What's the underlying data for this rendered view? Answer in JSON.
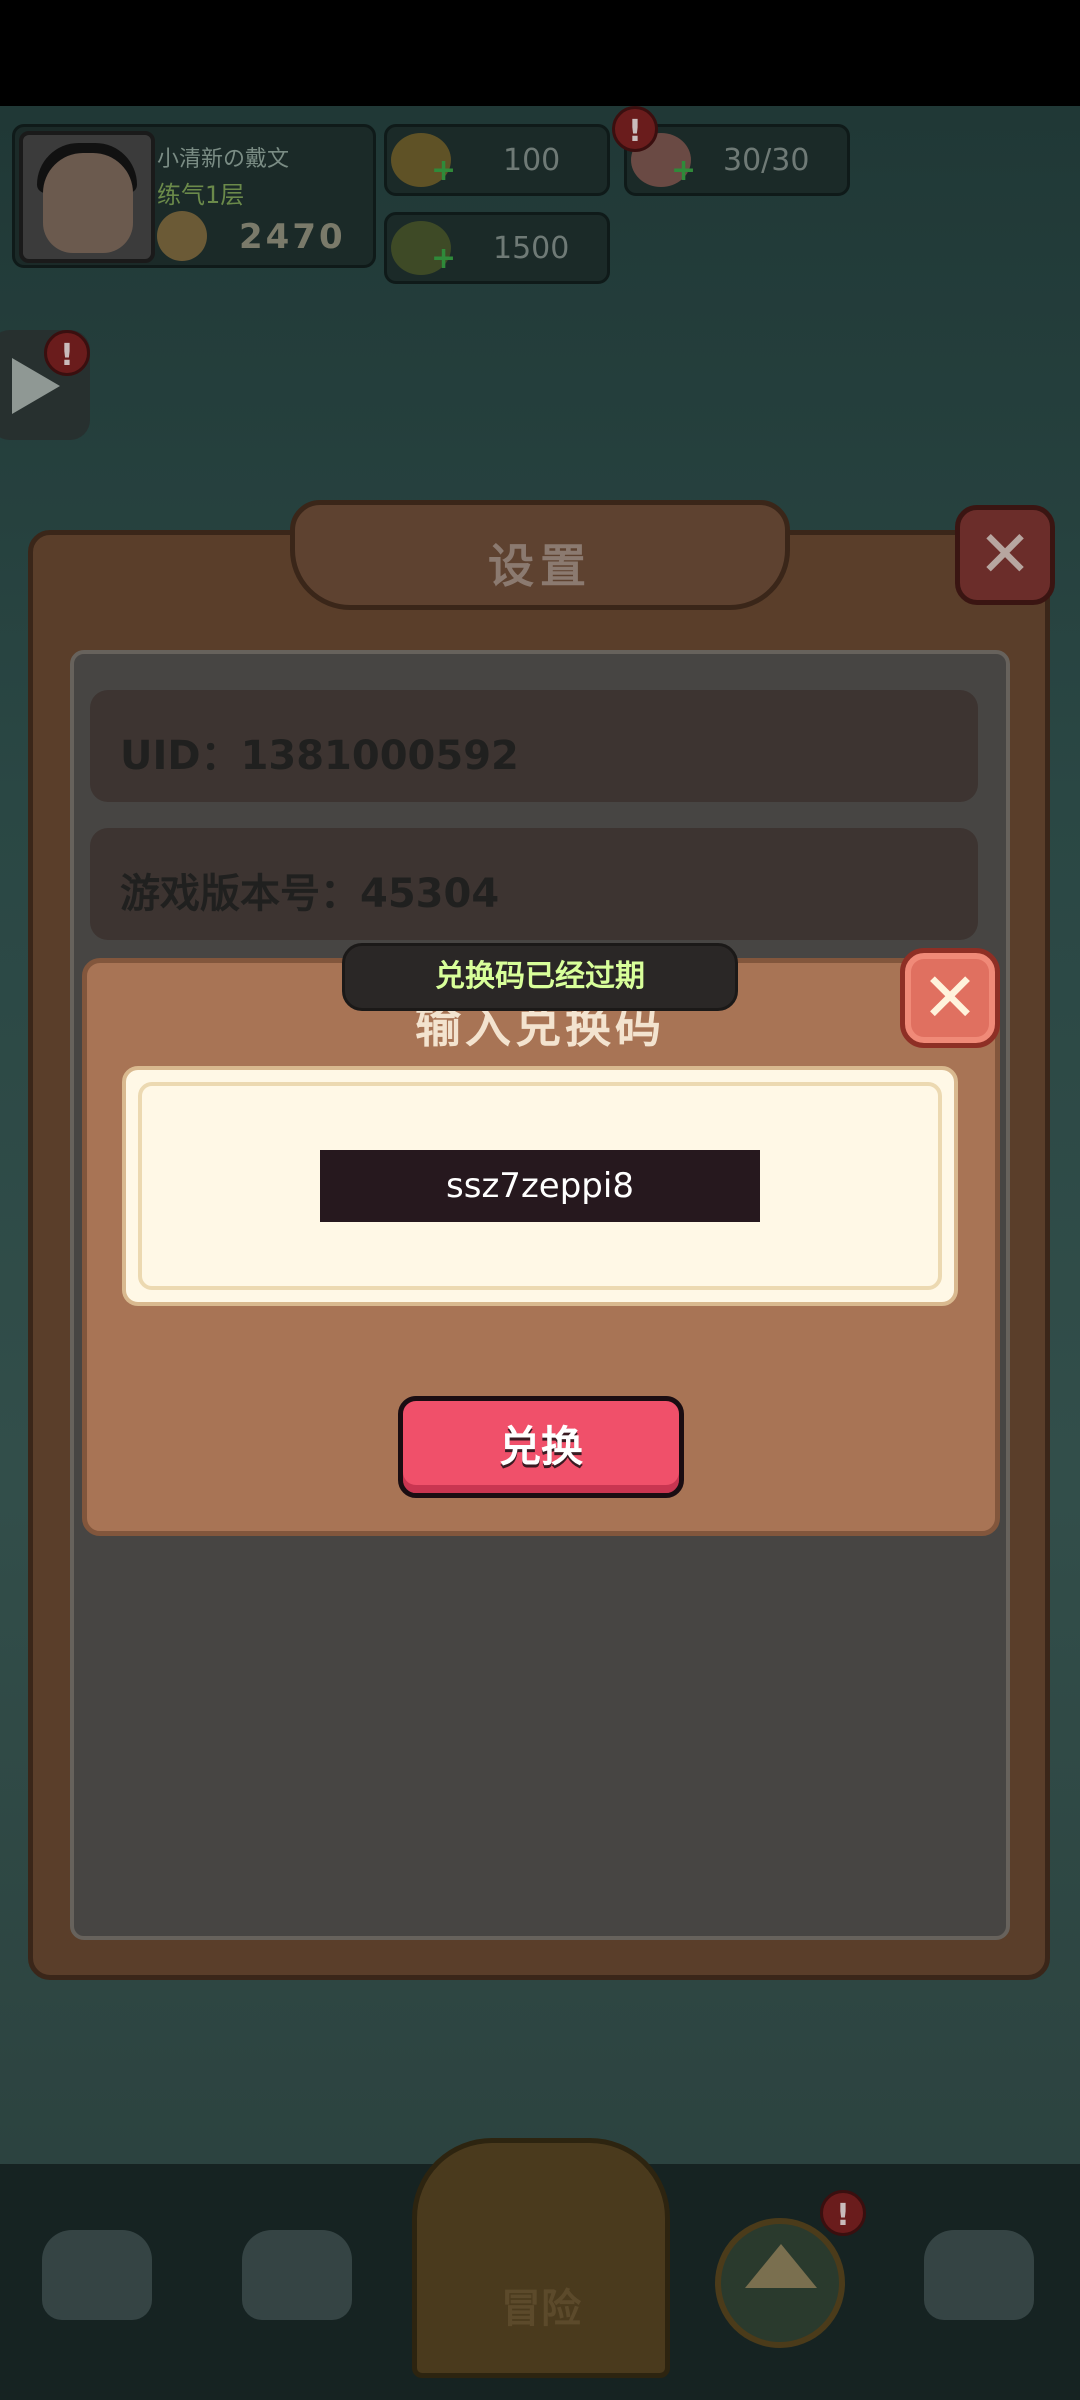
{
  "hud": {
    "player_name": "小清新の戴文",
    "player_rank": "练气1层",
    "power_value": "2470",
    "gold_value": "100",
    "stamina_value": "30/30",
    "coin_value": "1500",
    "alert_mark": "!"
  },
  "settings": {
    "title": "设置",
    "uid_text": "UID：1381000592",
    "version_text": "游戏版本号：45304",
    "close_symbol": "✕"
  },
  "redeem": {
    "title": "输入兑换码",
    "code_value": "ssz7zeppi8",
    "button_label": "兑换",
    "close_symbol": "✕"
  },
  "toast": {
    "message": "兑换码已经过期"
  },
  "bottom_nav": {
    "center_label": "冒险"
  },
  "colors": {
    "toast_text": "#d8ff9a",
    "redeem_button": "#f0506a",
    "close_button": "#e07060",
    "modal_bg": "#a87455"
  },
  "icons": [
    "avatar",
    "power-icon",
    "gold-icon",
    "stamina-icon",
    "coin-icon",
    "play-icon",
    "close-icon",
    "upgrade-arrow-icon"
  ]
}
